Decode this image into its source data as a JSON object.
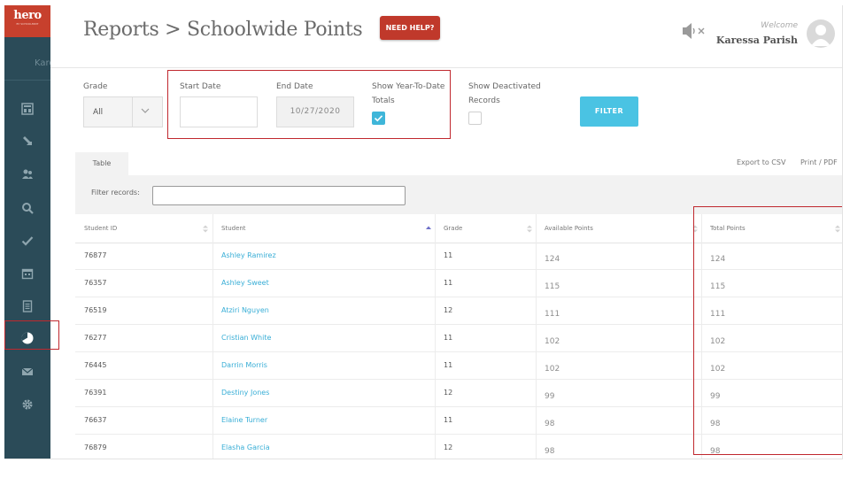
{
  "sidebar": {
    "logo_text": "hero",
    "logo_subtext": "BY SCHOOLMINT",
    "user_stub": "Karess",
    "active_item": "reports-icon"
  },
  "header": {
    "breadcrumb": "Reports > Schoolwide Points",
    "help_button": "NEED HELP?",
    "welcome_label": "Welcome",
    "user_name": "Karessa Parish"
  },
  "filters": {
    "grade_label": "Grade",
    "grade_value": "All",
    "start_date_label": "Start Date",
    "start_date_value": "",
    "end_date_label": "End Date",
    "end_date_value": "10/27/2020",
    "ytd_label_line1": "Show Year-To-Date",
    "ytd_label_line2": "Totals",
    "ytd_checked": true,
    "deactivated_label_line1": "Show Deactivated",
    "deactivated_label_line2": "Records",
    "deactivated_checked": false,
    "filter_button": "FILTER"
  },
  "table_area": {
    "tab_label": "Table",
    "export_csv": "Export to CSV",
    "print_pdf": "Print / PDF",
    "filter_records_label": "Filter records:",
    "filter_records_value": "",
    "columns": [
      "Student ID",
      "Student",
      "Grade",
      "Available Points",
      "Total Points"
    ],
    "sorted_column": "Student",
    "rows": [
      {
        "id": "76877",
        "student": "Ashley Ramirez",
        "grade": "11",
        "available": "124",
        "total": "124"
      },
      {
        "id": "76357",
        "student": "Ashley Sweet",
        "grade": "11",
        "available": "115",
        "total": "115"
      },
      {
        "id": "76519",
        "student": "Atziri Nguyen",
        "grade": "12",
        "available": "111",
        "total": "111"
      },
      {
        "id": "76277",
        "student": "Cristian White",
        "grade": "11",
        "available": "102",
        "total": "102"
      },
      {
        "id": "76445",
        "student": "Darrin Morris",
        "grade": "11",
        "available": "102",
        "total": "102"
      },
      {
        "id": "76391",
        "student": "Destiny Jones",
        "grade": "12",
        "available": "99",
        "total": "99"
      },
      {
        "id": "76637",
        "student": "Elaine Turner",
        "grade": "11",
        "available": "98",
        "total": "98"
      },
      {
        "id": "76879",
        "student": "Elasha Garcia",
        "grade": "12",
        "available": "98",
        "total": "98"
      }
    ]
  },
  "colors": {
    "sidebar_bg": "#2b4b58",
    "logo_bg": "#c7402d",
    "help_button_bg": "#c0392b",
    "accent_blue": "#4ac3e3",
    "link_blue": "#39aed6",
    "highlight_red": "#c0282e"
  }
}
